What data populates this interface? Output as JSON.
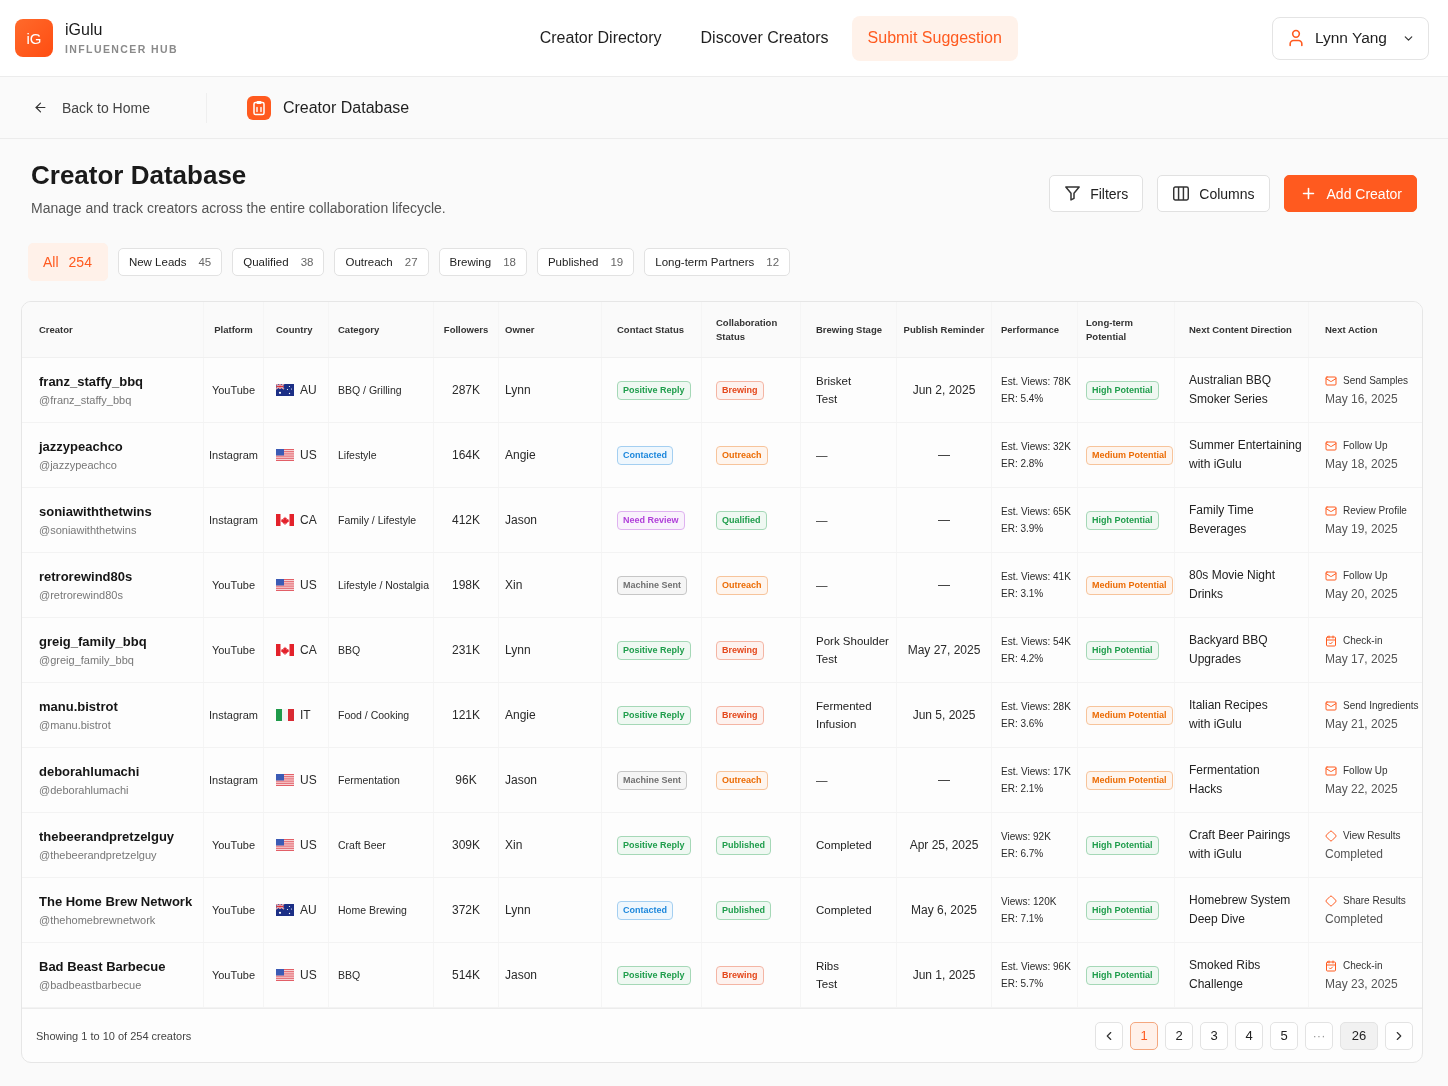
{
  "app": {
    "logo": "iG",
    "name": "iGulu",
    "tagline": "INFLUENCER HUB"
  },
  "nav": [
    {
      "label": "Creator Directory",
      "selected": false
    },
    {
      "label": "Discover Creators",
      "selected": false
    },
    {
      "label": "Submit Suggestion",
      "selected": true
    }
  ],
  "user": {
    "name": "Lynn Yang"
  },
  "breadcrumb": {
    "back": "Back to Home",
    "current": "Creator Database"
  },
  "page": {
    "title": "Creator Database",
    "subtitle": "Manage and track creators across the entire collaboration lifecycle."
  },
  "actions": [
    {
      "label": "Filters",
      "kind": "filter"
    },
    {
      "label": "Columns",
      "kind": "columns"
    },
    {
      "label": "Add Creator",
      "kind": "add"
    }
  ],
  "stage_filters": [
    {
      "label": "All",
      "count": "254",
      "selected": true
    },
    {
      "label": "New Leads",
      "count": "45",
      "selected": false
    },
    {
      "label": "Qualified",
      "count": "38",
      "selected": false
    },
    {
      "label": "Outreach",
      "count": "27",
      "selected": false
    },
    {
      "label": "Brewing",
      "count": "18",
      "selected": false
    },
    {
      "label": "Published",
      "count": "19",
      "selected": false
    },
    {
      "label": "Long-term Partners",
      "count": "12",
      "selected": false
    }
  ],
  "table": {
    "columns": [
      "Creator",
      "Platform",
      "Country",
      "Category",
      "Followers",
      "Owner",
      "Contact Status",
      "Collaboration Status",
      "Brewing Stage",
      "Publish Reminder",
      "Performance",
      "Long-term Potential",
      "Next Content Direction",
      "Next Action"
    ],
    "rows": [
      {
        "creator": {
          "name": "franz_staffy_bbq",
          "handle": "@franz_staffy_bbq"
        },
        "platform": "YouTube",
        "country": {
          "code": "AU",
          "kind": "australia"
        },
        "category": "BBQ / Grilling",
        "followers": "287K",
        "owner": "Lynn",
        "contact_status": {
          "label": "Positive Reply",
          "color": "#1f9d4c"
        },
        "collaboration_status": {
          "label": "Brewing",
          "color": "#e4471b"
        },
        "brewing_stage": [
          "Brisket",
          "Test"
        ],
        "publish_reminder": "Jun 2, 2025",
        "performance": {
          "views": "Est. Views: 78K",
          "er": "ER: 5.4%"
        },
        "potential": {
          "label": "High Potential",
          "color": "#1f9d4c"
        },
        "next_content": [
          "Australian BBQ",
          "Smoker Series"
        ],
        "next_action": {
          "kind": "message",
          "label": "Send Samples",
          "detail": "May 16, 2025"
        }
      },
      {
        "creator": {
          "name": "jazzypeachco",
          "handle": "@jazzypeachco"
        },
        "platform": "Instagram",
        "country": {
          "code": "US",
          "kind": "usa"
        },
        "category": "Lifestyle",
        "followers": "164K",
        "owner": "Angie",
        "contact_status": {
          "label": "Contacted",
          "color": "#1c87dc"
        },
        "collaboration_status": {
          "label": "Outreach",
          "color": "#ec6c05"
        },
        "brewing_stage": [
          "—"
        ],
        "publish_reminder": "—",
        "performance": {
          "views": "Est. Views: 32K",
          "er": "ER: 2.8%"
        },
        "potential": {
          "label": "Medium Potential",
          "color": "#ec6c05"
        },
        "next_content": [
          "Summer Entertaining",
          "with iGulu"
        ],
        "next_action": {
          "kind": "message",
          "label": "Follow Up",
          "detail": "May 18, 2025"
        }
      },
      {
        "creator": {
          "name": "soniawiththetwins",
          "handle": "@soniawiththetwins"
        },
        "platform": "Instagram",
        "country": {
          "code": "CA",
          "kind": "canada"
        },
        "category": "Family / Lifestyle",
        "followers": "412K",
        "owner": "Jason",
        "contact_status": {
          "label": "Need Review",
          "color": "#b03fd9"
        },
        "collaboration_status": {
          "label": "Qualified",
          "color": "#1f9d4c"
        },
        "brewing_stage": [
          "—"
        ],
        "publish_reminder": "—",
        "performance": {
          "views": "Est. Views: 65K",
          "er": "ER: 3.9%"
        },
        "potential": {
          "label": "High Potential",
          "color": "#1f9d4c"
        },
        "next_content": [
          "Family Time",
          "Beverages"
        ],
        "next_action": {
          "kind": "message",
          "label": "Review Profile",
          "detail": "May 19, 2025"
        }
      },
      {
        "creator": {
          "name": "retrorewind80s",
          "handle": "@retrorewind80s"
        },
        "platform": "YouTube",
        "country": {
          "code": "US",
          "kind": "usa"
        },
        "category": "Lifestyle / Nostalgia",
        "followers": "198K",
        "owner": "Xin",
        "contact_status": {
          "label": "Machine Sent",
          "color": "#707070"
        },
        "collaboration_status": {
          "label": "Outreach",
          "color": "#ec6c05"
        },
        "brewing_stage": [
          "—"
        ],
        "publish_reminder": "—",
        "performance": {
          "views": "Est. Views: 41K",
          "er": "ER: 3.1%"
        },
        "potential": {
          "label": "Medium Potential",
          "color": "#ec6c05"
        },
        "next_content": [
          "80s Movie Night",
          "Drinks"
        ],
        "next_action": {
          "kind": "message",
          "label": "Follow Up",
          "detail": "May 20, 2025"
        }
      },
      {
        "creator": {
          "name": "greig_family_bbq",
          "handle": "@greig_family_bbq"
        },
        "platform": "YouTube",
        "country": {
          "code": "CA",
          "kind": "canada"
        },
        "category": "BBQ",
        "followers": "231K",
        "owner": "Lynn",
        "contact_status": {
          "label": "Positive Reply",
          "color": "#1f9d4c"
        },
        "collaboration_status": {
          "label": "Brewing",
          "color": "#e4471b"
        },
        "brewing_stage": [
          "Pork Shoulder",
          "Test"
        ],
        "publish_reminder": "May 27, 2025",
        "performance": {
          "views": "Est. Views: 54K",
          "er": "ER: 4.2%"
        },
        "potential": {
          "label": "High Potential",
          "color": "#1f9d4c"
        },
        "next_content": [
          "Backyard BBQ",
          "Upgrades"
        ],
        "next_action": {
          "kind": "meeting",
          "label": "Check-in",
          "detail": "May 17, 2025"
        }
      },
      {
        "creator": {
          "name": "manu.bistrot",
          "handle": "@manu.bistrot"
        },
        "platform": "Instagram",
        "country": {
          "code": "IT",
          "kind": "italy"
        },
        "category": "Food / Cooking",
        "followers": "121K",
        "owner": "Angie",
        "contact_status": {
          "label": "Positive Reply",
          "color": "#1f9d4c"
        },
        "collaboration_status": {
          "label": "Brewing",
          "color": "#e4471b"
        },
        "brewing_stage": [
          "Fermented",
          "Infusion"
        ],
        "publish_reminder": "Jun 5, 2025",
        "performance": {
          "views": "Est. Views: 28K",
          "er": "ER: 3.6%"
        },
        "potential": {
          "label": "Medium Potential",
          "color": "#ec6c05"
        },
        "next_content": [
          "Italian Recipes",
          "with iGulu"
        ],
        "next_action": {
          "kind": "message",
          "label": "Send Ingredients",
          "detail": "May 21, 2025"
        }
      },
      {
        "creator": {
          "name": "deborahlumachi",
          "handle": "@deborahlumachi"
        },
        "platform": "Instagram",
        "country": {
          "code": "US",
          "kind": "usa"
        },
        "category": "Fermentation",
        "followers": "96K",
        "owner": "Jason",
        "contact_status": {
          "label": "Machine Sent",
          "color": "#707070"
        },
        "collaboration_status": {
          "label": "Outreach",
          "color": "#ec6c05"
        },
        "brewing_stage": [
          "—"
        ],
        "publish_reminder": "—",
        "performance": {
          "views": "Est. Views: 17K",
          "er": "ER: 2.1%"
        },
        "potential": {
          "label": "Medium Potential",
          "color": "#ec6c05"
        },
        "next_content": [
          "Fermentation",
          "Hacks"
        ],
        "next_action": {
          "kind": "message",
          "label": "Follow Up",
          "detail": "May 22, 2025"
        }
      },
      {
        "creator": {
          "name": "thebeerandpretzelguy",
          "handle": "@thebeerandpretzelguy"
        },
        "platform": "YouTube",
        "country": {
          "code": "US",
          "kind": "usa"
        },
        "category": "Craft Beer",
        "followers": "309K",
        "owner": "Xin",
        "contact_status": {
          "label": "Positive Reply",
          "color": "#1f9d4c"
        },
        "collaboration_status": {
          "label": "Published",
          "color": "#1f9d4c"
        },
        "brewing_stage": [
          "Completed"
        ],
        "publish_reminder": "Apr 25, 2025",
        "performance": {
          "views": "Views: 92K",
          "er": "ER: 6.7%"
        },
        "potential": {
          "label": "High Potential",
          "color": "#1f9d4c"
        },
        "next_content": [
          "Craft Beer Pairings",
          "with iGulu"
        ],
        "next_action": {
          "kind": "results",
          "label": "View Results",
          "detail": "Completed"
        }
      },
      {
        "creator": {
          "name": "The Home Brew Network",
          "handle": "@thehomebrewnetwork"
        },
        "platform": "YouTube",
        "country": {
          "code": "AU",
          "kind": "australia"
        },
        "category": "Home Brewing",
        "followers": "372K",
        "owner": "Lynn",
        "contact_status": {
          "label": "Contacted",
          "color": "#1c87dc"
        },
        "collaboration_status": {
          "label": "Published",
          "color": "#1f9d4c"
        },
        "brewing_stage": [
          "Completed"
        ],
        "publish_reminder": "May 6, 2025",
        "performance": {
          "views": "Views: 120K",
          "er": "ER: 7.1%"
        },
        "potential": {
          "label": "High Potential",
          "color": "#1f9d4c"
        },
        "next_content": [
          "Homebrew System",
          "Deep Dive"
        ],
        "next_action": {
          "kind": "results",
          "label": "Share Results",
          "detail": "Completed"
        }
      },
      {
        "creator": {
          "name": "Bad Beast Barbecue",
          "handle": "@badbeastbarbecue"
        },
        "platform": "YouTube",
        "country": {
          "code": "US",
          "kind": "usa"
        },
        "category": "BBQ",
        "followers": "514K",
        "owner": "Jason",
        "contact_status": {
          "label": "Positive Reply",
          "color": "#1f9d4c"
        },
        "collaboration_status": {
          "label": "Brewing",
          "color": "#e4471b"
        },
        "brewing_stage": [
          "Ribs",
          "Test"
        ],
        "publish_reminder": "Jun 1, 2025",
        "performance": {
          "views": "Est. Views: 96K",
          "er": "ER: 5.7%"
        },
        "potential": {
          "label": "High Potential",
          "color": "#1f9d4c"
        },
        "next_content": [
          "Smoked Ribs",
          "Challenge"
        ],
        "next_action": {
          "kind": "meeting",
          "label": "Check-in",
          "detail": "May 23, 2025"
        }
      }
    ]
  },
  "footer": {
    "summary": "Showing 1 to 10 of 254 creators",
    "pages": [
      {
        "label": "1",
        "kind": "page",
        "selected": true,
        "hovered": false
      },
      {
        "label": "2",
        "kind": "page",
        "selected": false,
        "hovered": false
      },
      {
        "label": "3",
        "kind": "page",
        "selected": false,
        "hovered": false
      },
      {
        "label": "4",
        "kind": "page",
        "selected": false,
        "hovered": false
      },
      {
        "label": "5",
        "kind": "page",
        "selected": false,
        "hovered": false
      },
      {
        "label": "···",
        "kind": "gap",
        "selected": false,
        "hovered": false
      },
      {
        "label": "26",
        "kind": "page",
        "selected": false,
        "hovered": true
      }
    ]
  }
}
